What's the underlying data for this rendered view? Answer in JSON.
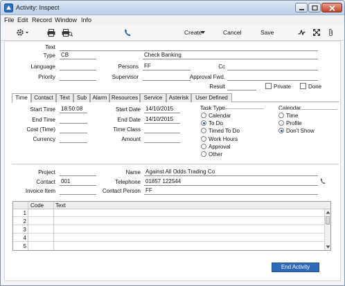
{
  "window": {
    "title": "Activity: Inspect"
  },
  "menu": [
    "File",
    "Edit",
    "Record",
    "Window",
    "Info"
  ],
  "toolbar": {
    "create_label": "Create",
    "cancel_label": "Cancel",
    "save_label": "Save"
  },
  "header": {
    "text_label": "Text",
    "text_value": "",
    "type_label": "Type",
    "type_value": "CB",
    "type_name": "Check Banking",
    "language_label": "Language",
    "language_value": "",
    "persons_label": "Persons",
    "persons_value": "FF",
    "cc_label": "Cc",
    "cc_value": "",
    "priority_label": "Priority",
    "priority_value": "",
    "supervisor_label": "Supervisor",
    "supervisor_value": "",
    "approval_label": "Approval Fwd.",
    "approval_value": "",
    "result_label": "Result",
    "result_value": "",
    "private_label": "Private",
    "done_label": "Done"
  },
  "tabs": [
    "Time",
    "Contact",
    "Text",
    "Sub",
    "Alarm",
    "Resources",
    "Service",
    "Asterisk",
    "User Defined"
  ],
  "time_tab": {
    "start_time_label": "Start Time",
    "start_time_value": "18:50:08",
    "end_time_label": "End Time",
    "end_time_value": "",
    "cost_label": "Cost (Time)",
    "cost_value": "",
    "currency_label": "Currency",
    "currency_value": "",
    "start_date_label": "Start Date",
    "start_date_value": "14/10/2015",
    "end_date_label": "End Date",
    "end_date_value": "14/10/2015",
    "time_class_label": "Time Class",
    "time_class_value": "",
    "amount_label": "Amount",
    "amount_value": "",
    "task_type_label": "Task Type",
    "task_types": [
      "Calendar",
      "To Do",
      "Timed To Do",
      "Work Hours",
      "Approval",
      "Other"
    ],
    "task_type_selected": "To Do",
    "calendar_label": "Calendar",
    "calendar_options": [
      "Time",
      "Profile",
      "Don't Show"
    ],
    "calendar_selected": "Don't Show"
  },
  "contact_section": {
    "project_label": "Project",
    "project_value": "",
    "contact_label": "Contact",
    "contact_value": "001",
    "invoice_item_label": "Invoice Item",
    "invoice_item_value": "",
    "name_label": "Name",
    "name_value": "Against All Odds Trading Co",
    "telephone_label": "Telephone",
    "telephone_value": "01857 122544",
    "contact_person_label": "Contact Person",
    "contact_person_value": "FF"
  },
  "grid": {
    "columns": [
      "Code",
      "Text"
    ],
    "rows": [
      "1",
      "2",
      "3",
      "4",
      "5"
    ]
  },
  "footer": {
    "end_activity_label": "End Activity"
  }
}
